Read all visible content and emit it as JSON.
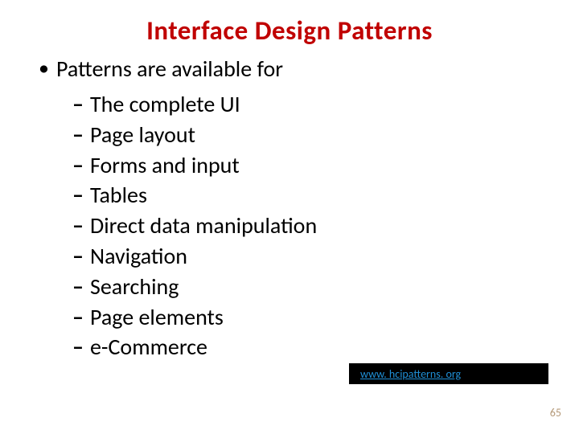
{
  "title": "Interface Design Patterns",
  "top_bullet": "Patterns are available for",
  "sub_items": {
    "0": "The complete UI",
    "1": "Page layout",
    "2": "Forms and input",
    "3": "Tables",
    "4": "Direct data manipulation",
    "5": "Navigation",
    "6": "Searching",
    "7": "Page elements",
    "8": "e-Commerce"
  },
  "link": {
    "label": "www. hcipatterns. org"
  },
  "page_number": "65"
}
